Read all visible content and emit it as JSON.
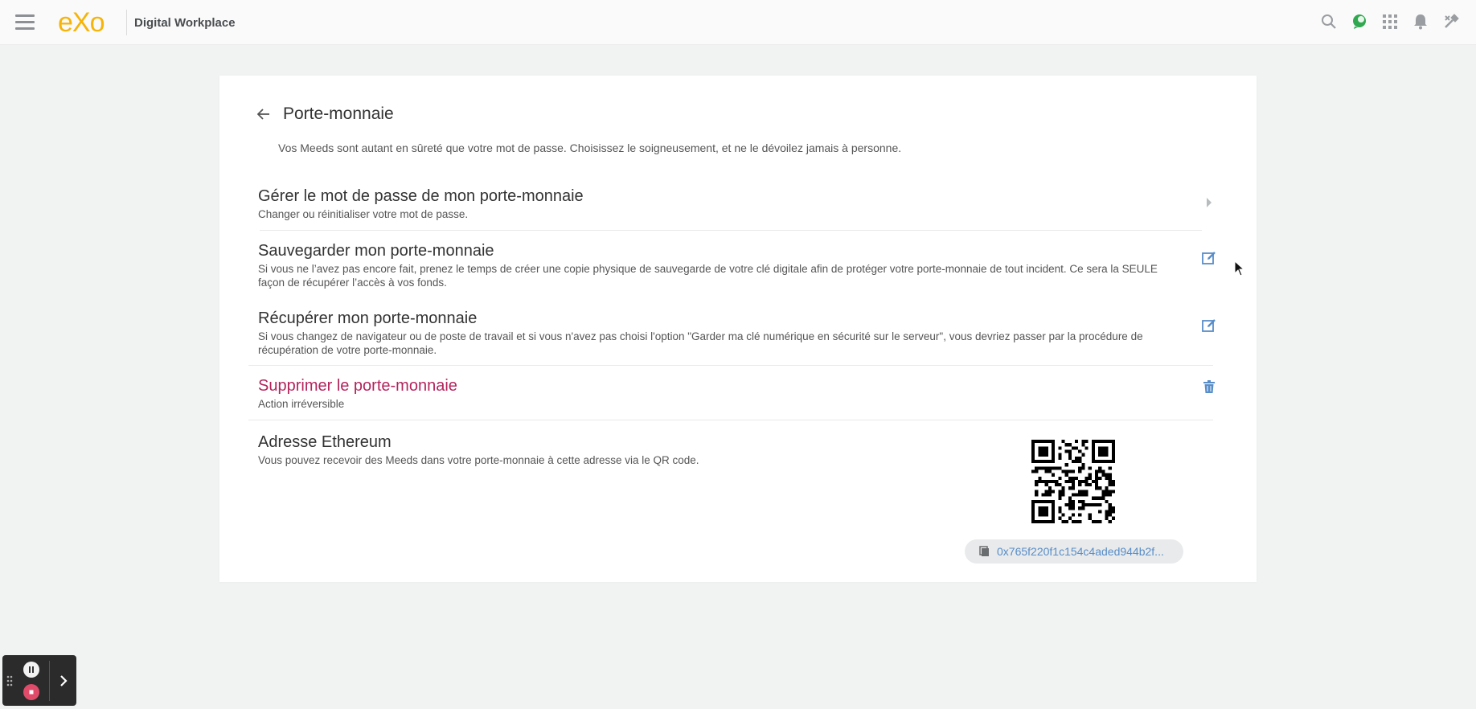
{
  "topbar": {
    "logo_text": "eXo",
    "site_name": "Digital Workplace",
    "icons": [
      "search-icon",
      "chat-icon",
      "apps-grid-icon",
      "notifications-bell-icon",
      "admin-tools-icon"
    ],
    "accent_color": "#f6b40a"
  },
  "page": {
    "title": "Porte-monnaie",
    "intro": "Vos Meeds sont autant en sûreté que votre mot de passe. Choisissez le soigneusement, et ne le dévoilez jamais à personne."
  },
  "items": [
    {
      "title": "Gérer le mot de passe de mon porte-monnaie",
      "desc": "Changer ou réinitialiser votre mot de passe.",
      "action_icon": "chevron-right-icon"
    },
    {
      "title": "Sauvegarder mon porte-monnaie",
      "desc": "Si vous ne l’avez pas encore fait, prenez le temps de créer une copie physique de sauvegarde de votre clé digitale afin de protéger votre porte-monnaie de tout incident. Ce sera la SEULE façon de récupérer l’accès à vos fonds.",
      "action_icon": "edit-icon"
    },
    {
      "title": "Récupérer mon porte-monnaie",
      "desc": "Si vous changez de navigateur ou de poste de travail et si vous n'avez pas choisi l'option \"Garder ma clé numérique en sécurité sur le serveur\", vous devriez passer par la procédure de récupération de votre porte-monnaie.",
      "action_icon": "edit-icon"
    },
    {
      "title": "Supprimer le porte-monnaie",
      "desc": "Action irréversible",
      "action_icon": "trash-icon",
      "danger_color": "#b3245c"
    },
    {
      "title": "Adresse Ethereum",
      "desc": "Vous pouvez recevoir des Meeds dans votre porte-monnaie à cette adresse via le QR code."
    }
  ],
  "wallet": {
    "address_display": "0x765f220f1c154c4aded944b2f...",
    "qr_icon": "qr-code-icon",
    "link_color": "#578dc9"
  },
  "recorder": {
    "buttons": [
      "pause-icon",
      "stop-icon",
      "chevron-right-icon"
    ]
  }
}
